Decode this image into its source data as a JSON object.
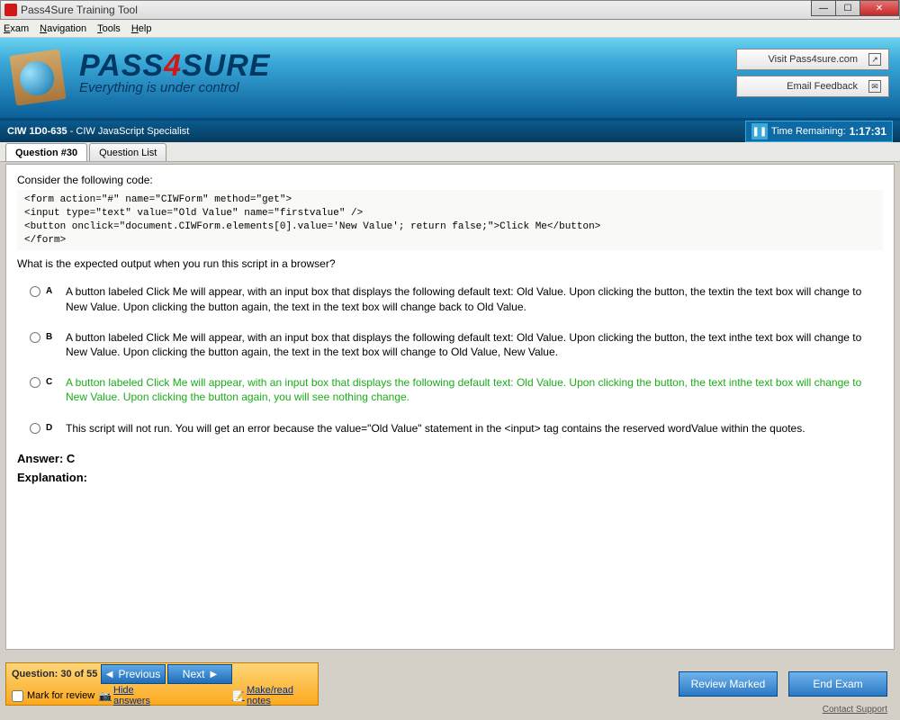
{
  "window": {
    "title": "Pass4Sure Training Tool"
  },
  "menu": {
    "items": [
      "Exam",
      "Navigation",
      "Tools",
      "Help"
    ]
  },
  "banner": {
    "brand_pre": "PASS",
    "brand_num": "4",
    "brand_post": "SURE",
    "tagline": "Everything is under control",
    "visit_btn": "Visit Pass4sure.com",
    "email_btn": "Email Feedback"
  },
  "infobar": {
    "exam_code": "CIW 1D0-635",
    "exam_name": " - CIW JavaScript Specialist",
    "timer_label": "Time Remaining:",
    "time": "1:17:31"
  },
  "tabs": {
    "question": "Question #30",
    "list": "Question List"
  },
  "question": {
    "intro": "Consider the following code:",
    "code": "<form action=\"#\" name=\"CIWForm\" method=\"get\">\n<input type=\"text\" value=\"Old Value\" name=\"firstvalue\" />\n<button onclick=\"document.CIWForm.elements[0].value='New Value'; return false;\">Click Me</button>\n</form>",
    "prompt": "What is the expected output when you run this script in a browser?",
    "options": [
      {
        "letter": "A",
        "text": "A button labeled Click Me will appear, with an input box that displays the following default text: Old Value. Upon clicking the button, the textin the text box will change to New Value. Upon clicking the button again, the text in the text box will change back to Old Value.",
        "correct": false
      },
      {
        "letter": "B",
        "text": "A button labeled Click Me will appear, with an input box that displays the following default text: Old Value. Upon clicking the button, the text inthe text box will change to New Value. Upon clicking the button again, the text in the text box will change to Old Value, New Value.",
        "correct": false
      },
      {
        "letter": "C",
        "text": "A button labeled Click Me will appear, with an input box that displays the following default text: Old Value. Upon clicking the button, the text inthe text box will change to New Value. Upon clicking the button again, you will see nothing change.",
        "correct": true
      },
      {
        "letter": "D",
        "text": "This script will not run. You will get an error because the value=\"Old Value\" statement in the <input> tag contains the reserved wordValue within the quotes.",
        "correct": false
      }
    ],
    "answer_label": "Answer: C",
    "explanation_label": "Explanation:"
  },
  "bottom": {
    "position": "Question: 30 of 55",
    "previous": "Previous",
    "next": "Next",
    "mark": "Mark for review",
    "hide": "Hide answers",
    "notes": "Make/read notes",
    "review": "Review Marked",
    "end": "End Exam",
    "contact": "Contact Support"
  }
}
